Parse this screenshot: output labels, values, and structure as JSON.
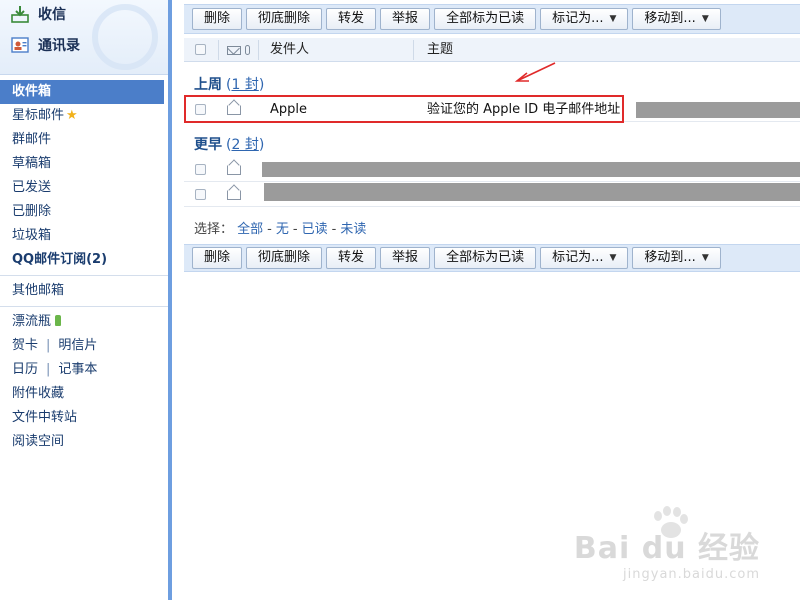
{
  "sidebar": {
    "top_actions": {
      "receive": "收信",
      "contacts": "通讯录"
    },
    "folders": [
      {
        "label": "收件箱"
      },
      {
        "label": "星标邮件"
      },
      {
        "label": "群邮件"
      },
      {
        "label": "草稿箱"
      },
      {
        "label": "已发送"
      },
      {
        "label": "已删除"
      },
      {
        "label": "垃圾箱"
      },
      {
        "label": "QQ邮件订阅(2)"
      }
    ],
    "other_mailbox": "其他邮箱",
    "drift_bottle": "漂流瓶",
    "greeting_card": "贺卡",
    "postcard": "明信片",
    "calendar": "日历",
    "notebook": "记事本",
    "attachments": "附件收藏",
    "file_transfer": "文件中转站",
    "reading_space": "阅读空间"
  },
  "toolbar": {
    "delete": "删除",
    "delete_forever": "彻底删除",
    "forward": "转发",
    "report": "举报",
    "mark_all_read": "全部标为已读",
    "mark_as": "标记为...",
    "move_to": "移动到..."
  },
  "list_header": {
    "sender": "发件人",
    "subject": "主题"
  },
  "groups": [
    {
      "title": "上周",
      "count": "1 封"
    },
    {
      "title": "更早",
      "count": "2 封"
    }
  ],
  "emails": [
    {
      "sender": "Apple",
      "subject": "验证您的 Apple ID 电子邮件地址"
    }
  ],
  "select_bar": {
    "label": "选择：",
    "all": "全部",
    "none": "无",
    "read": "已读",
    "unread": "未读"
  },
  "watermark": {
    "main": "Bai du 经验",
    "sub": "jingyan.baidu.com"
  },
  "colors": {
    "accent": "#4b7ec9",
    "toolbar_bg": "#dde9f8",
    "annotation": "#e02a2a",
    "redaction": "#9b9b9b"
  }
}
